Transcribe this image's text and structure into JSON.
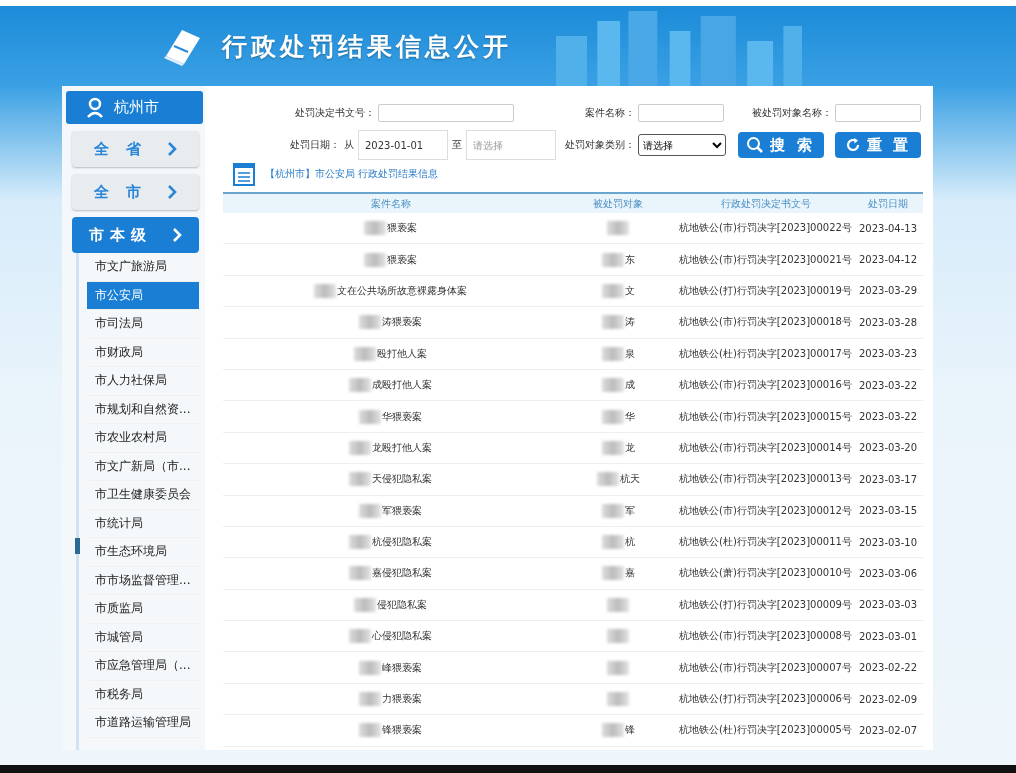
{
  "header": {
    "title": "行政处罚结果信息公开"
  },
  "sidebar": {
    "city": "杭州市",
    "levels": [
      {
        "label": "全 省",
        "selected": false
      },
      {
        "label": "全 市",
        "selected": false
      },
      {
        "label": "市本级",
        "selected": true
      }
    ],
    "items": [
      {
        "label": "市文广旅游局",
        "selected": false
      },
      {
        "label": "市公安局",
        "selected": true
      },
      {
        "label": "市司法局",
        "selected": false
      },
      {
        "label": "市财政局",
        "selected": false
      },
      {
        "label": "市人力社保局",
        "selected": false
      },
      {
        "label": "市规划和自然资...",
        "selected": false
      },
      {
        "label": "市农业农村局",
        "selected": false
      },
      {
        "label": "市文广新局（市...",
        "selected": false
      },
      {
        "label": "市卫生健康委员会",
        "selected": false
      },
      {
        "label": "市统计局",
        "selected": false
      },
      {
        "label": "市生态环境局",
        "selected": false
      },
      {
        "label": "市市场监督管理...",
        "selected": false
      },
      {
        "label": "市质监局",
        "selected": false
      },
      {
        "label": "市城管局",
        "selected": false
      },
      {
        "label": "市应急管理局（...",
        "selected": false
      },
      {
        "label": "市税务局",
        "selected": false
      },
      {
        "label": "市道路运输管理局",
        "selected": false
      }
    ]
  },
  "search": {
    "doc_no_label": "处罚决定书文号：",
    "case_name_label": "案件名称：",
    "subject_name_label": "被处罚对象名称：",
    "date_label": "处罚日期：",
    "date_from": "从",
    "date_start": "2023-01-01",
    "date_to": "至",
    "date_end_placeholder": "请选择",
    "category_label": "处罚对象类别：",
    "category_value": "请选择",
    "search_button": "搜 索",
    "reset_button": "重 置"
  },
  "breadcrumb": "【杭州市】市公安局 行政处罚结果信息",
  "table": {
    "columns": [
      "案件名称",
      "被处罚对象",
      "行政处罚决定书文号",
      "处罚日期"
    ],
    "rows": [
      {
        "case": "猥亵案",
        "subject": "",
        "doc_no": "杭地铁公(市)行罚决字[2023]00022号",
        "date": "2023-04-13"
      },
      {
        "case": "猥亵案",
        "subject": "东",
        "doc_no": "杭地铁公(市)行罚决字[2023]00021号",
        "date": "2023-04-12"
      },
      {
        "case": "文在公共场所故意裸露身体案",
        "subject": "文",
        "doc_no": "杭地铁公(打)行罚决字[2023]00019号",
        "date": "2023-03-29"
      },
      {
        "case": "涛猥亵案",
        "subject": "涛",
        "doc_no": "杭地铁公(市)行罚决字[2023]00018号",
        "date": "2023-03-28"
      },
      {
        "case": "殴打他人案",
        "subject": "泉",
        "doc_no": "杭地铁公(杜)行罚决字[2023]00017号",
        "date": "2023-03-23"
      },
      {
        "case": "成殴打他人案",
        "subject": "成",
        "doc_no": "杭地铁公(市)行罚决字[2023]00016号",
        "date": "2023-03-22"
      },
      {
        "case": "华猥亵案",
        "subject": "华",
        "doc_no": "杭地铁公(市)行罚决字[2023]00015号",
        "date": "2023-03-22"
      },
      {
        "case": "龙殴打他人案",
        "subject": "龙",
        "doc_no": "杭地铁公(市)行罚决字[2023]00014号",
        "date": "2023-03-20"
      },
      {
        "case": "天侵犯隐私案",
        "subject": "杭天",
        "doc_no": "杭地铁公(市)行罚决字[2023]00013号",
        "date": "2023-03-17"
      },
      {
        "case": "军猥亵案",
        "subject": "军",
        "doc_no": "杭地铁公(市)行罚决字[2023]00012号",
        "date": "2023-03-15"
      },
      {
        "case": "杭侵犯隐私案",
        "subject": "杭",
        "doc_no": "杭地铁公(杜)行罚决字[2023]00011号",
        "date": "2023-03-10"
      },
      {
        "case": "嘉侵犯隐私案",
        "subject": "嘉",
        "doc_no": "杭地铁公(萧)行罚决字[2023]00010号",
        "date": "2023-03-06"
      },
      {
        "case": "侵犯隐私案",
        "subject": "",
        "doc_no": "杭地铁公(打)行罚决字[2023]00009号",
        "date": "2023-03-03"
      },
      {
        "case": "心侵犯隐私案",
        "subject": "",
        "doc_no": "杭地铁公(市)行罚决字[2023]00008号",
        "date": "2023-03-01"
      },
      {
        "case": "峰猥亵案",
        "subject": "",
        "doc_no": "杭地铁公(市)行罚决字[2023]00007号",
        "date": "2023-02-22"
      },
      {
        "case": "力猥亵案",
        "subject": "",
        "doc_no": "杭地铁公(打)行罚决字[2023]00006号",
        "date": "2023-02-09"
      },
      {
        "case": "锋猥亵案",
        "subject": "锋",
        "doc_no": "杭地铁公(杜)行罚决字[2023]00005号",
        "date": "2023-02-07"
      }
    ]
  }
}
